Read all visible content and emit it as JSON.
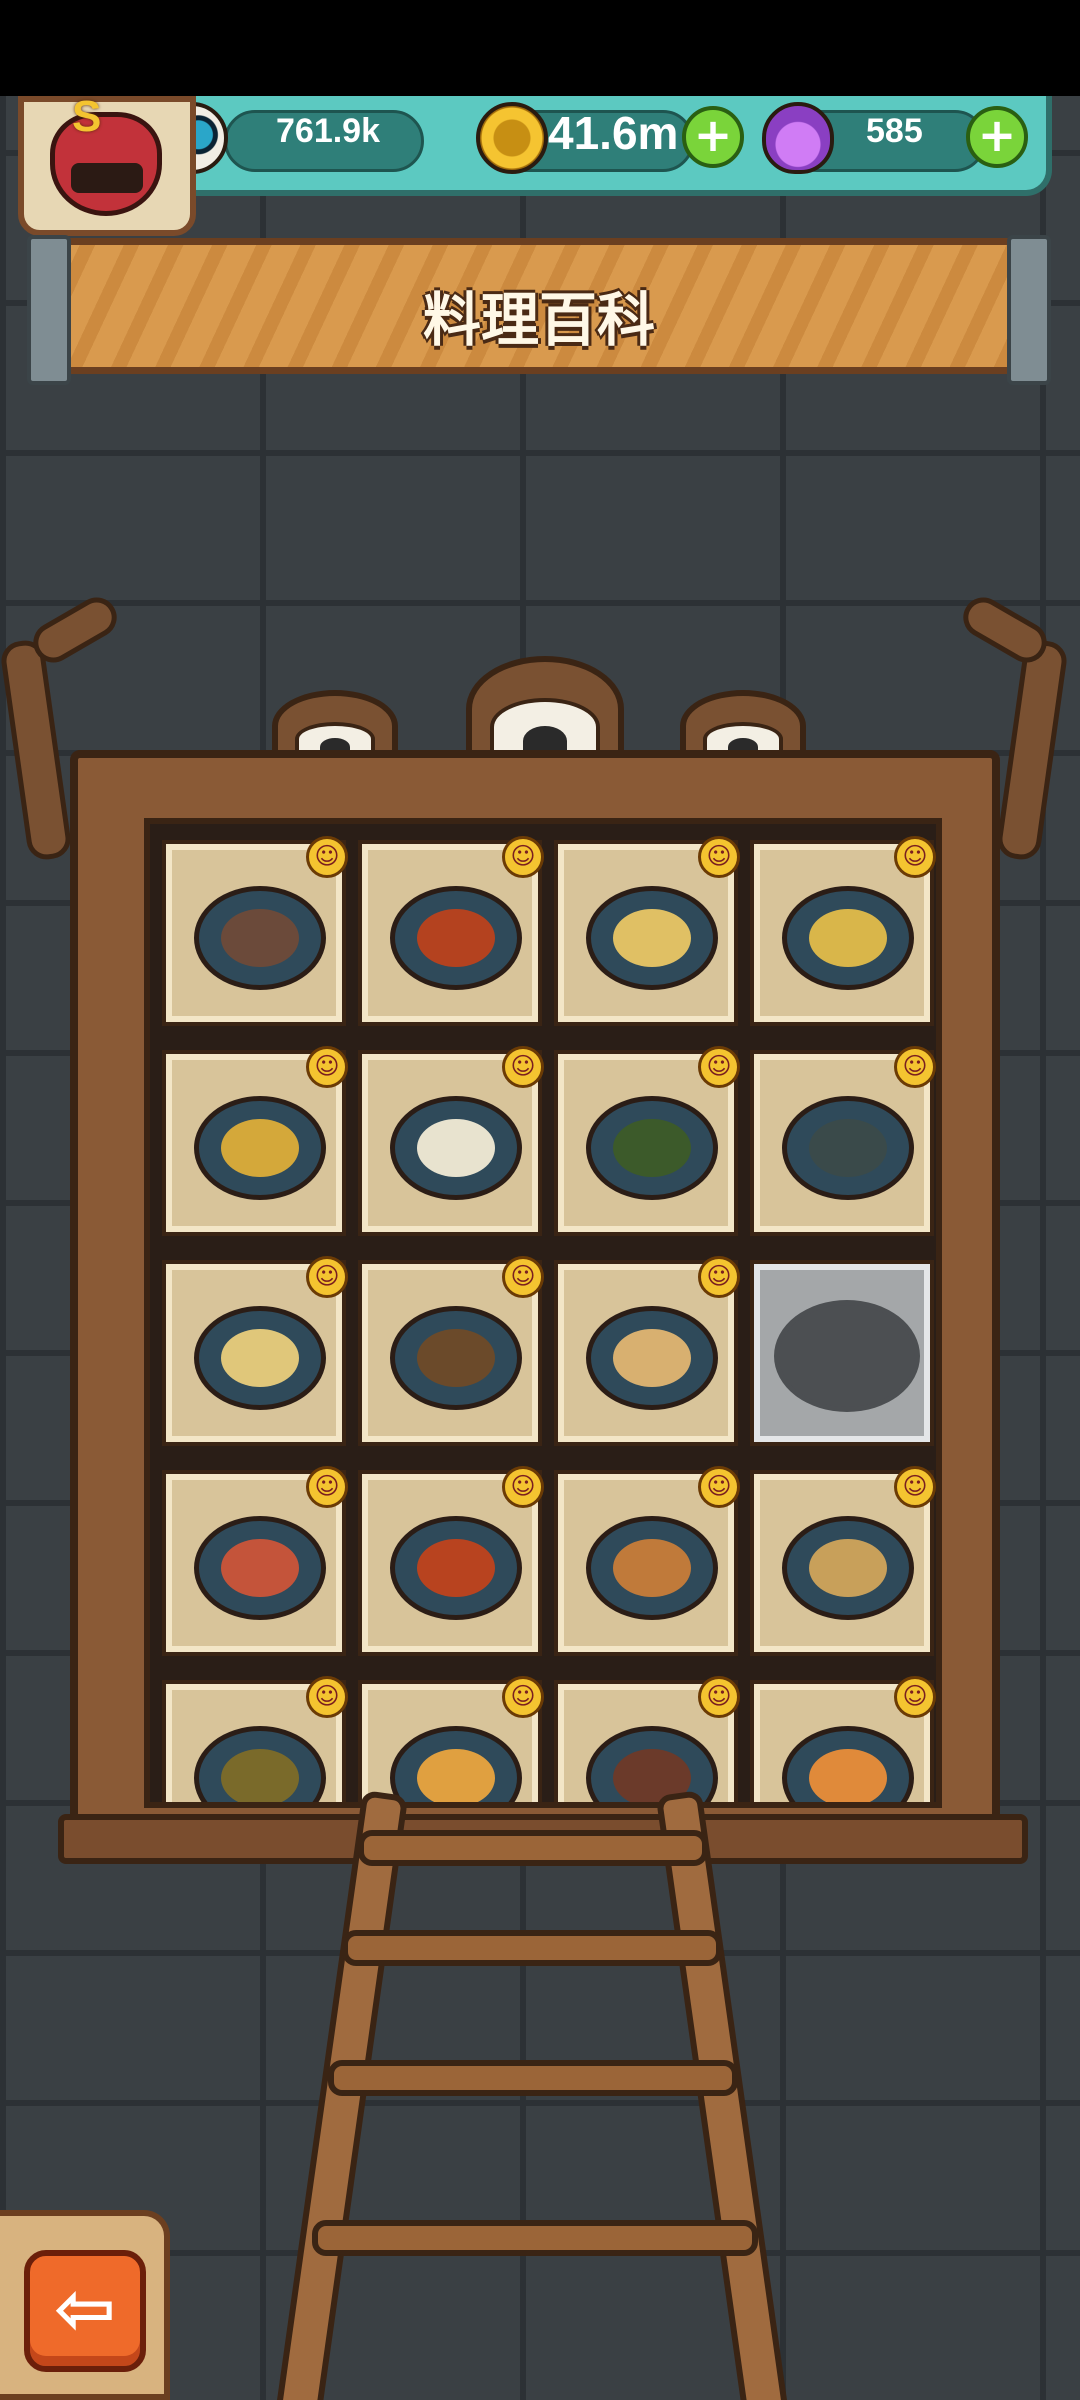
{
  "header": {
    "resources": [
      {
        "name": "eyeballs",
        "icon": "eyeball-icon",
        "value": "761.9k",
        "has_plus": false
      },
      {
        "name": "coins",
        "icon": "coin-icon",
        "value": "41.6m",
        "has_plus": true
      },
      {
        "name": "potions",
        "icon": "potion-icon",
        "value": "585",
        "has_plus": true
      }
    ],
    "avatar_letter": "S"
  },
  "title": "料理百科",
  "grid": {
    "columns": 4,
    "items": [
      {
        "dish": "sliced-meat-platter",
        "unlocked": true,
        "color": "#6b4a3a"
      },
      {
        "dish": "chili-chicken",
        "unlocked": true,
        "color": "#b4421f"
      },
      {
        "dish": "rice-dish",
        "unlocked": true,
        "color": "#e0c064"
      },
      {
        "dish": "seafood-pot",
        "unlocked": true,
        "color": "#d9b64a"
      },
      {
        "dish": "vegetable-salad",
        "unlocked": true,
        "color": "#d4a83a"
      },
      {
        "dish": "bread-roll",
        "unlocked": true,
        "color": "#e8e3cf"
      },
      {
        "dish": "seaweed-squares",
        "unlocked": true,
        "color": "#3c5a2a"
      },
      {
        "dish": "stuffed-buns",
        "unlocked": true,
        "color": "#3a4a4a"
      },
      {
        "dish": "egg-rolls",
        "unlocked": true,
        "color": "#e0c77a"
      },
      {
        "dish": "skewers-tray",
        "unlocked": true,
        "color": "#6b4a2a"
      },
      {
        "dish": "fried-rice-bowl",
        "unlocked": true,
        "color": "#d8b070"
      },
      {
        "dish": "locked",
        "unlocked": false,
        "color": "#4c4f52"
      },
      {
        "dish": "crab-plate",
        "unlocked": true,
        "color": "#c4543a"
      },
      {
        "dish": "crawfish-plate",
        "unlocked": true,
        "color": "#b8431f"
      },
      {
        "dish": "pizza-pan",
        "unlocked": true,
        "color": "#c07a3a"
      },
      {
        "dish": "noodle-plate",
        "unlocked": true,
        "color": "#c8a05a"
      },
      {
        "dish": "pepper-stirfry",
        "unlocked": true,
        "color": "#7a6a2a"
      },
      {
        "dish": "pancake-stack",
        "unlocked": true,
        "color": "#e0a040"
      },
      {
        "dish": "spaghetti",
        "unlocked": true,
        "color": "#6b3a2a"
      },
      {
        "dish": "soup-bowl",
        "unlocked": true,
        "color": "#e08a3a"
      }
    ]
  },
  "footer": {
    "back_icon": "arrow-left-icon",
    "back_glyph": "⇦"
  },
  "colors": {
    "resource_bar": "#5cc9c1",
    "title_plank": "#d99a4e",
    "cabinet": "#8a5a36",
    "back_button": "#ef6a2a"
  }
}
